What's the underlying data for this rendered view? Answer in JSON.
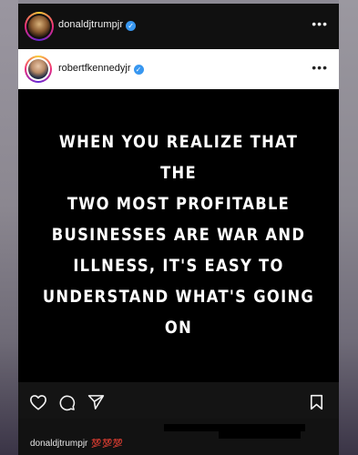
{
  "outer_post": {
    "username": "donaldjtrumpjr",
    "verified": true,
    "more": "•••"
  },
  "shared_post": {
    "username": "robertfkennedyjr",
    "verified": true,
    "more": "•••",
    "quote_lines": [
      "WHEN YOU REALIZE THAT THE",
      "TWO MOST PROFITABLE",
      "BUSINESSES ARE WAR AND",
      "ILLNESS, IT'S EASY TO",
      "UNDERSTAND WHAT'S GOING ON"
    ]
  },
  "actions": {
    "icons": [
      "heart-icon",
      "comment-icon",
      "share-icon",
      "bookmark-icon"
    ]
  },
  "caption": {
    "username": "donaldjtrumpjr",
    "emoji": "💯💯💯"
  },
  "colors": {
    "verified": "#3897f0",
    "post_bg": "#000000",
    "header_bg": "#101010"
  }
}
